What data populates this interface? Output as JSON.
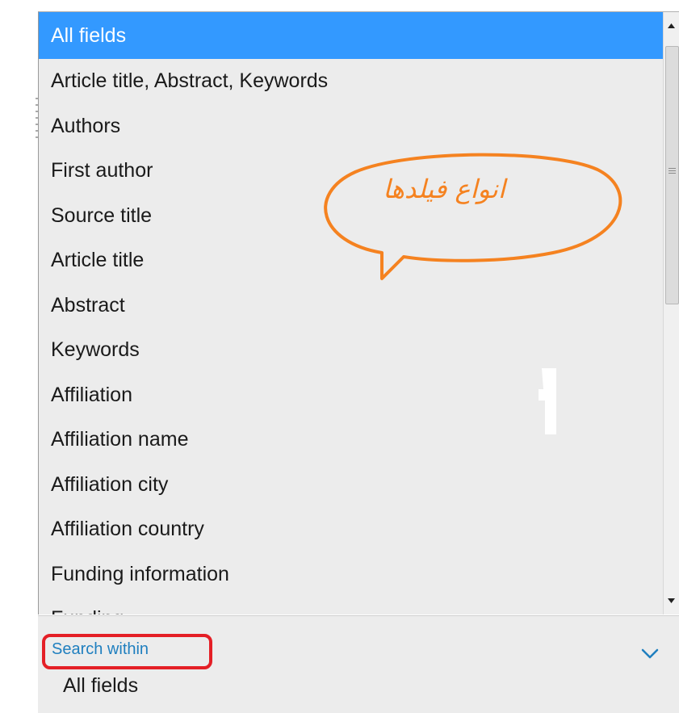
{
  "dropdown": {
    "items": [
      {
        "label": "All fields",
        "selected": true
      },
      {
        "label": "Article title, Abstract, Keywords"
      },
      {
        "label": "Authors"
      },
      {
        "label": "First author"
      },
      {
        "label": "Source title"
      },
      {
        "label": "Article title"
      },
      {
        "label": "Abstract"
      },
      {
        "label": "Keywords"
      },
      {
        "label": "Affiliation"
      },
      {
        "label": "Affiliation name"
      },
      {
        "label": "Affiliation city"
      },
      {
        "label": "Affiliation country"
      },
      {
        "label": "Funding information"
      },
      {
        "label": "Funding..."
      }
    ]
  },
  "annotation": {
    "text": "انواع فیلدها",
    "color": "#f58220"
  },
  "search_within": {
    "label": "Search within",
    "value": "All fields",
    "highlight_color": "#e41f26"
  },
  "colors": {
    "selected_bg": "#3399ff",
    "list_bg": "#ececec",
    "link_blue": "#1f7fbf"
  }
}
